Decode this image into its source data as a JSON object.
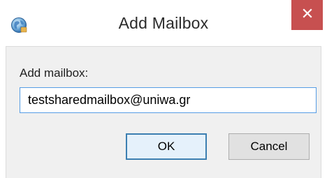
{
  "window": {
    "title": "Add Mailbox",
    "app_icon": "outlook-globe-icon",
    "close_icon": "close-icon",
    "close_color": "#c75050"
  },
  "form": {
    "label": "Add mailbox:",
    "value": "testsharedmailbox@uniwa.gr"
  },
  "buttons": {
    "ok_label": "OK",
    "cancel_label": "Cancel"
  },
  "colors": {
    "focus_border": "#569de5",
    "default_button_border": "#3c7fb1"
  }
}
